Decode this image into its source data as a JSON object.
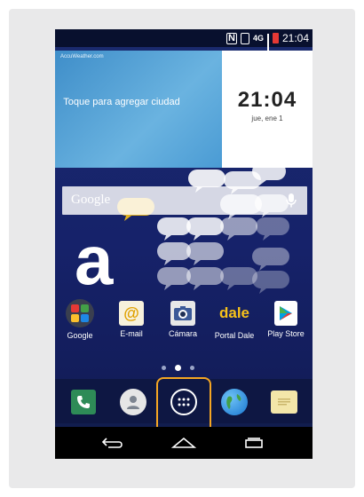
{
  "status": {
    "time": "21:04",
    "data_label": "4G"
  },
  "weather_widget": {
    "brand": "AccuWeather.com",
    "message": "Toque para agregar ciudad"
  },
  "clock_widget": {
    "time": "21:04",
    "date": "jue, ene 1"
  },
  "search": {
    "label": "Google"
  },
  "apps": [
    {
      "label": "Google",
      "icon": "google-folder-icon"
    },
    {
      "label": "E-mail",
      "icon": "email-icon"
    },
    {
      "label": "Cámara",
      "icon": "camera-icon"
    },
    {
      "label": "Portal Dale",
      "icon": "dale-icon",
      "icon_text": "dale"
    },
    {
      "label": "Play Store",
      "icon": "play-store-icon"
    }
  ],
  "brand_letter": "a",
  "pager": {
    "pages": 3,
    "active": 2
  },
  "dock": [
    {
      "icon": "phone-icon"
    },
    {
      "icon": "contacts-icon"
    },
    {
      "icon": "apps-drawer-icon"
    },
    {
      "icon": "browser-icon"
    },
    {
      "icon": "messaging-icon"
    }
  ],
  "navbar": [
    "back-icon",
    "home-icon",
    "recents-icon"
  ],
  "colors": {
    "highlight": "#f5a623",
    "accent_yellow": "#f7c21a",
    "wallpaper": "#16226a"
  }
}
